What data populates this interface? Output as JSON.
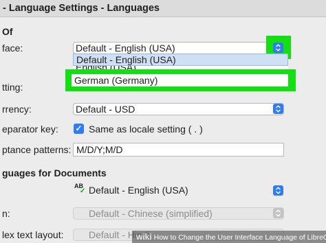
{
  "window": {
    "title": "- Language Settings - Languages"
  },
  "sections": {
    "language_of": "Of",
    "languages_for_documents": "guages for Documents"
  },
  "ui_language": {
    "label": "face:",
    "value": "Default - English (USA)",
    "options": [
      "Default - English (USA)",
      "English (USA)",
      "German (Germany)"
    ]
  },
  "locale_setting": {
    "label": "tting:"
  },
  "currency": {
    "label": "rrency:",
    "value": "Default - USD"
  },
  "decimal_separator": {
    "label": "eparator key:",
    "checkbox_label": "Same as locale setting ( . )",
    "checked": true
  },
  "acceptance_patterns": {
    "label": "ptance patterns:",
    "value": "M/D/Y;M/D"
  },
  "western": {
    "value": "Default - English (USA)",
    "icon": "AB"
  },
  "asian": {
    "label": "n:",
    "value": "Default - Chinese (simplified)"
  },
  "ctl": {
    "label": "lex text layout:",
    "value": "Default - Hindi"
  },
  "watermark": {
    "brand": "wiki",
    "text": "How to Change the User Interface Language of LibreOffice"
  },
  "colors": {
    "accent": "#2f7cf6",
    "highlight": "#12e012"
  }
}
